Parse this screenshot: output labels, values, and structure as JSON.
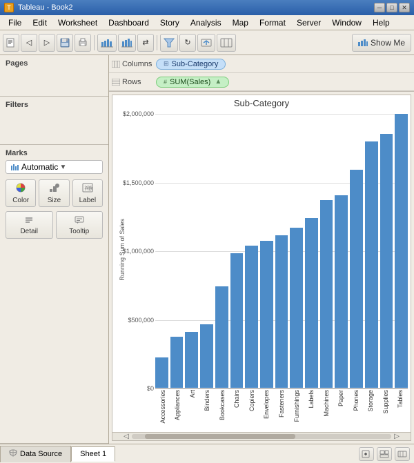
{
  "titlebar": {
    "title": "Tableau - Book2",
    "icon": "T",
    "min_label": "─",
    "max_label": "□",
    "close_label": "✕"
  },
  "menubar": {
    "items": [
      "File",
      "Edit",
      "Worksheet",
      "Dashboard",
      "Story",
      "Analysis",
      "Map",
      "Format",
      "Server",
      "Window",
      "Help"
    ]
  },
  "toolbar": {
    "show_me_label": "Show Me"
  },
  "left_panel": {
    "pages_label": "Pages",
    "filters_label": "Filters",
    "marks_label": "Marks",
    "marks_type": "Automatic",
    "color_label": "Color",
    "size_label": "Size",
    "label_label": "Label",
    "detail_label": "Detail",
    "tooltip_label": "Tooltip"
  },
  "shelves": {
    "columns_label": "Columns",
    "rows_label": "Rows",
    "columns_pill": "Sub-Category",
    "rows_pill": "SUM(Sales)"
  },
  "chart": {
    "title": "Sub-Category",
    "y_axis_label": "Running Sum of Sales",
    "y_ticks": [
      "$2,000,000",
      "$1,500,000",
      "$1,000,000",
      "$500,000",
      "$0"
    ],
    "bars": [
      {
        "label": "Accessories",
        "height_pct": 12
      },
      {
        "label": "Appliances",
        "height_pct": 20
      },
      {
        "label": "Art",
        "height_pct": 22
      },
      {
        "label": "Binders",
        "height_pct": 25
      },
      {
        "label": "Bookcases",
        "height_pct": 40
      },
      {
        "label": "Chairs",
        "height_pct": 53
      },
      {
        "label": "Copiers",
        "height_pct": 56
      },
      {
        "label": "Envelopes",
        "height_pct": 58
      },
      {
        "label": "Fasteners",
        "height_pct": 60
      },
      {
        "label": "Furnishings",
        "height_pct": 63
      },
      {
        "label": "Labels",
        "height_pct": 67
      },
      {
        "label": "Machines",
        "height_pct": 74
      },
      {
        "label": "Paper",
        "height_pct": 76
      },
      {
        "label": "Phones",
        "height_pct": 86
      },
      {
        "label": "Storage",
        "height_pct": 97
      },
      {
        "label": "Supplies",
        "height_pct": 100
      },
      {
        "label": "Tables",
        "height_pct": 108
      }
    ]
  },
  "statusbar": {
    "datasource_label": "Data Source",
    "sheet_label": "Sheet 1"
  }
}
